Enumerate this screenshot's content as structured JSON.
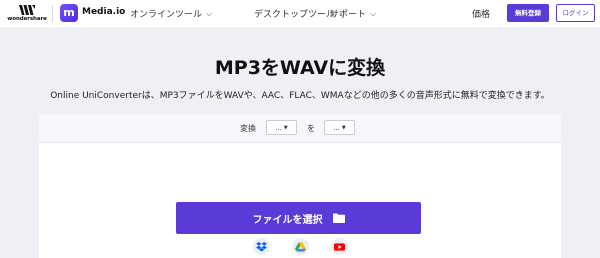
{
  "header": {
    "brand_text": "wondershare",
    "product_logo_letter": "m",
    "product_name": "Media.io",
    "nav": [
      {
        "label": "オンラインツール",
        "chevron": "chevron-down-icon"
      },
      {
        "label": "デスクトップツール",
        "chevron": "chevron-down-icon"
      },
      {
        "label": "サポート",
        "chevron": "chevron-down-icon"
      }
    ],
    "price_link": "価格",
    "signup_label": "無料登録",
    "login_label": "ログイン"
  },
  "hero": {
    "title": "MP3をWAVに変換",
    "subtitle": "Online UniConverterは、MP3ファイルをWAVや、AAC、FLAC、WMAなどの他の多くの音声形式に無料で変換できます。"
  },
  "converter": {
    "from_label": "変換",
    "from_value": "...",
    "to_label": "を",
    "to_value": "...",
    "choose_file_label": "ファイルを選択",
    "choose_file_icon": "folder-icon",
    "cloud_sources": [
      "dropbox-icon",
      "google-drive-icon",
      "youtube-icon"
    ]
  },
  "colors": {
    "accent": "#5b3bd8",
    "page_background": "#eef0f6",
    "card_background": "#ffffff"
  }
}
